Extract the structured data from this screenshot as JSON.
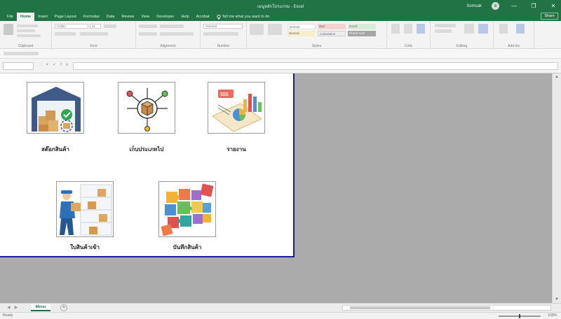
{
  "window": {
    "title": "เมนูหลักโปรแกรม - Excel",
    "user": "Somsak",
    "avatar_initial": "S",
    "controls": [
      "—",
      "❐",
      "✕"
    ]
  },
  "tabs": [
    {
      "label": "File",
      "active": false
    },
    {
      "label": "Home",
      "active": true
    },
    {
      "label": "Insert",
      "active": false
    },
    {
      "label": "Page Layout",
      "active": false
    },
    {
      "label": "Formulas",
      "active": false
    },
    {
      "label": "Data",
      "active": false
    },
    {
      "label": "Review",
      "active": false
    },
    {
      "label": "View",
      "active": false
    },
    {
      "label": "Developer",
      "active": false
    },
    {
      "label": "Help",
      "active": false
    },
    {
      "label": "Acrobat",
      "active": false
    }
  ],
  "tell_me": "Tell me what you want to do",
  "share": "Share",
  "ribbon": {
    "groups": [
      "Clipboard",
      "Font",
      "Alignment",
      "Number",
      "Styles",
      "Cells",
      "Editing",
      "Add-ins"
    ],
    "styles": [
      "Normal",
      "Bad",
      "Good",
      "Neutral",
      "Calculation",
      "Check Cell"
    ],
    "font_name": "Calibri",
    "font_size": "11",
    "number_format": "General"
  },
  "formula_bar": {
    "name_box": "",
    "fx": "fx",
    "value": ""
  },
  "menu_tiles": [
    {
      "label": "สต๊อกสินค้า",
      "icon": "warehouse-icon"
    },
    {
      "label": "เก็บประเภทไป",
      "icon": "package-network-icon"
    },
    {
      "label": "รายงาน",
      "icon": "report-chart-icon"
    },
    {
      "label": "ใบสินค้าเข้า",
      "icon": "worker-shelf-icon"
    },
    {
      "label": "บันทึกสินค้า",
      "icon": "puzzle-icon"
    }
  ],
  "sheet_tab": "Menu",
  "status": {
    "ready": "Ready",
    "zoom": "100%"
  },
  "colors": {
    "excel_green": "#217346",
    "panel_border": "#1c1c96"
  }
}
